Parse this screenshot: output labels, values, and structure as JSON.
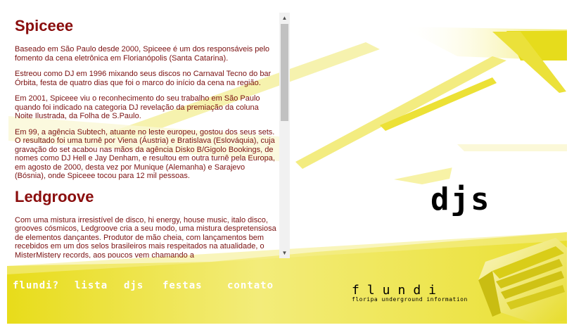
{
  "colors": {
    "accent": "#e8dc1a",
    "text": "#8a0d0d",
    "nav_text": "#ffffff"
  },
  "content": {
    "sections": [
      {
        "title": "Spiceee",
        "paragraphs": [
          "Baseado em São Paulo desde 2000, Spiceee é um dos responsáveis pelo fomento da cena eletrônica em Florianópolis (Santa Catarina).",
          "Estreou como DJ em 1996 mixando seus discos no Carnaval Tecno do bar Órbita, festa de quatro dias que foi o marco do início da cena na região.",
          "Em 2001, Spiceee viu o reconhecimento do seu trabalho em São Paulo quando foi indicado na categoria DJ revelação da premiação da coluna Noite Ilustrada, da Folha de S.Paulo.",
          "Em 99, a agência Subtech, atuante no leste europeu, gostou dos seus sets. O resultado foi uma turnê por Viena (Áustria) e Bratislava (Eslováquia), cuja gravação do set acabou nas mãos da agência Disko B/Gigolo Bookings, de nomes como DJ Hell e Jay Denham, e resultou em outra turnê pela Europa, em agosto de 2000, desta vez por Munique (Alemanha) e Sarajevo (Bósnia), onde Spiceee tocou para 12 mil pessoas."
        ]
      },
      {
        "title": "Ledgroove",
        "paragraphs": [
          "Com uma mistura irresistível de disco, hi energy, house music, italo disco, grooves cósmicos, Ledgroove cria a seu modo, uma mistura despretensiosa de elementos dançantes. Produtor de mão cheia, com lançamentos bem recebidos em um dos selos brasileiros mais respeitados na atualidade, o MisterMistery records, aos poucos vem chamando a"
        ]
      }
    ]
  },
  "nav": [
    "flundi?",
    "lista",
    "djs",
    "festas",
    "contato"
  ],
  "page_heading": "djs",
  "brand": {
    "name": "flundi",
    "tagline": "floripa underground information"
  },
  "icons": {
    "scroll_up": "triangle-up-icon",
    "scroll_down": "triangle-down-icon"
  }
}
